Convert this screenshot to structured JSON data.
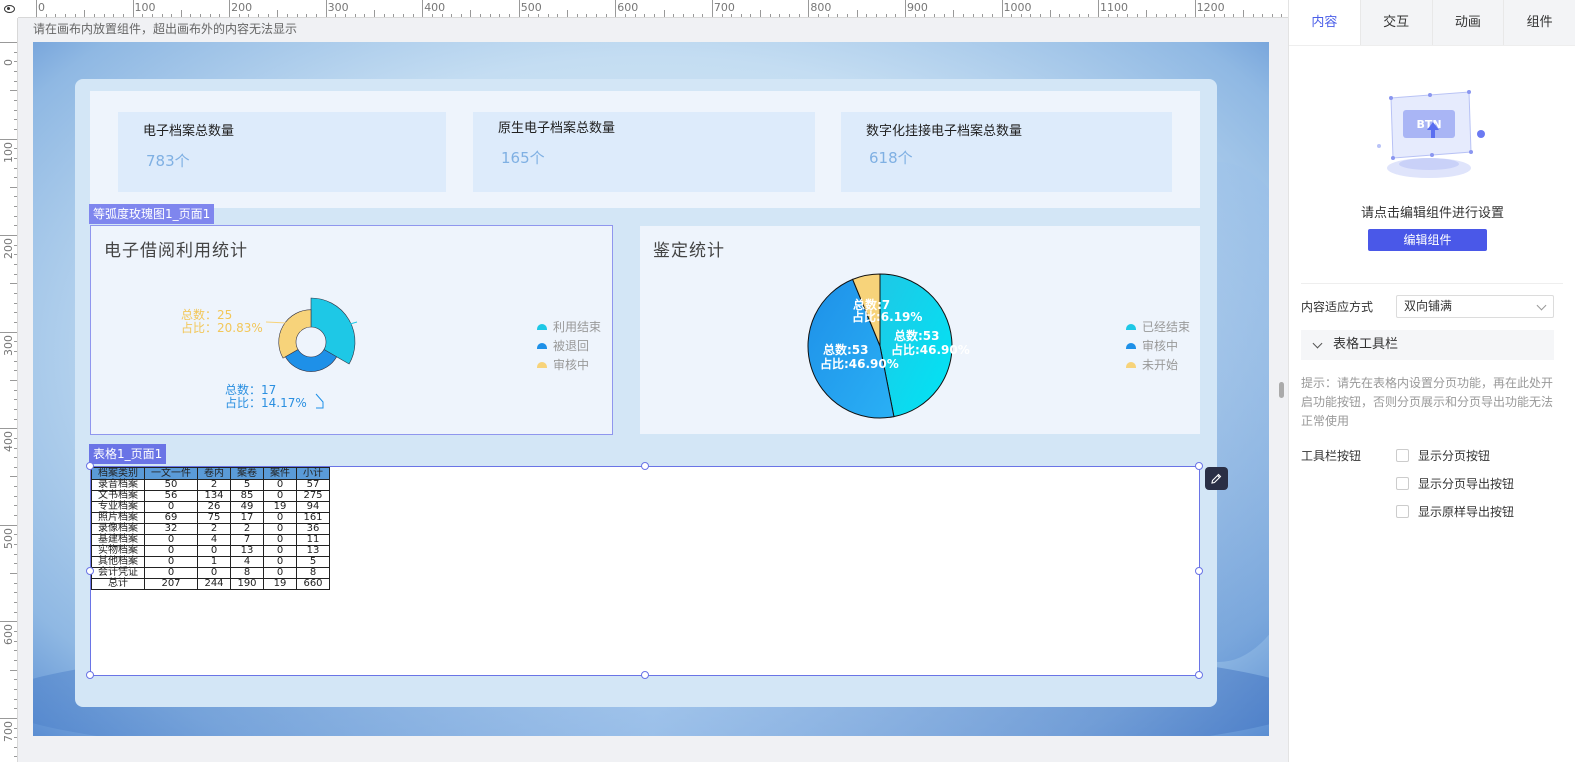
{
  "ruler": {
    "h_labels": [
      "0",
      "100",
      "200",
      "300",
      "400",
      "500",
      "600",
      "700",
      "800",
      "900",
      "1000",
      "1100",
      "1200"
    ],
    "v_labels": [
      "0",
      "100",
      "200",
      "300",
      "400",
      "500",
      "600",
      "700"
    ]
  },
  "canvas_hint": "请在画布内放置组件，超出画布外的内容无法显示",
  "stats": [
    {
      "title": "电子档案总数量",
      "value": "783个"
    },
    {
      "title": "原生电子档案总数量",
      "value": "165个"
    },
    {
      "title": "数字化挂接电子档案总数量",
      "value": "618个"
    }
  ],
  "rose_chart": {
    "tag": "等弧度玫瑰图1_页面1",
    "title": "电子借阅利用统计",
    "labels": [
      {
        "line1": "总数：25",
        "line2": "占比：20.83%"
      },
      {
        "line1": "总数：17",
        "line2": "占比：14.17%"
      }
    ],
    "legend": [
      {
        "name": "利用结束",
        "color": "#1ec8e6"
      },
      {
        "name": "被退回",
        "color": "#1e90e8"
      },
      {
        "name": "审核中",
        "color": "#f7d37a"
      }
    ]
  },
  "pie_chart": {
    "title": "鉴定统计",
    "labels": [
      {
        "line1": "总数:7",
        "line2": "占比:6.19%"
      },
      {
        "line1": "总数:53",
        "line2": "占比:46.90%"
      },
      {
        "line1": "总数:53",
        "line2": "占比:46.90%"
      }
    ],
    "legend": [
      {
        "name": "已经结束",
        "color": "#1ec8e6"
      },
      {
        "name": "审核中",
        "color": "#1e90e8"
      },
      {
        "name": "未开始",
        "color": "#f7d37a"
      }
    ]
  },
  "chart_data": [
    {
      "type": "pie",
      "variant": "rose",
      "title": "电子借阅利用统计",
      "series": [
        {
          "name": "利用结束",
          "value": 78
        },
        {
          "name": "被退回",
          "value": 17
        },
        {
          "name": "审核中",
          "value": 25
        }
      ]
    },
    {
      "type": "pie",
      "title": "鉴定统计",
      "series": [
        {
          "name": "已经结束",
          "value": 53
        },
        {
          "name": "审核中",
          "value": 53
        },
        {
          "name": "未开始",
          "value": 7
        }
      ]
    }
  ],
  "table": {
    "tag": "表格1_页面1",
    "headers": [
      "档案类别",
      "一文一件",
      "卷内",
      "案卷",
      "案件",
      "小计"
    ],
    "rows": [
      [
        "录音档案",
        "50",
        "2",
        "5",
        "0",
        "57"
      ],
      [
        "文书档案",
        "56",
        "134",
        "85",
        "0",
        "275"
      ],
      [
        "专业档案",
        "0",
        "26",
        "49",
        "19",
        "94"
      ],
      [
        "照片档案",
        "69",
        "75",
        "17",
        "0",
        "161"
      ],
      [
        "录像档案",
        "32",
        "2",
        "2",
        "0",
        "36"
      ],
      [
        "基建档案",
        "0",
        "4",
        "7",
        "0",
        "11"
      ],
      [
        "实物档案",
        "0",
        "0",
        "13",
        "0",
        "13"
      ],
      [
        "其他档案",
        "0",
        "1",
        "4",
        "0",
        "5"
      ],
      [
        "会计凭证",
        "0",
        "0",
        "8",
        "0",
        "8"
      ],
      [
        "总计",
        "207",
        "244",
        "190",
        "19",
        "660"
      ]
    ]
  },
  "side": {
    "tabs": [
      "内容",
      "交互",
      "动画",
      "组件"
    ],
    "illus_text": "BTN",
    "hint": "请点击编辑组件进行设置",
    "edit_button": "编辑组件",
    "fit_label": "内容适应方式",
    "fit_value": "双向铺满",
    "section_title": "表格工具栏",
    "tip": "提示：请先在表格内设置分页功能，再在此处开启功能按钮，否则分页展示和分页导出功能无法正常使用",
    "toolbar_label": "工具栏按钮",
    "options": [
      "显示分页按钮",
      "显示分页导出按钮",
      "显示原样导出按钮"
    ]
  }
}
